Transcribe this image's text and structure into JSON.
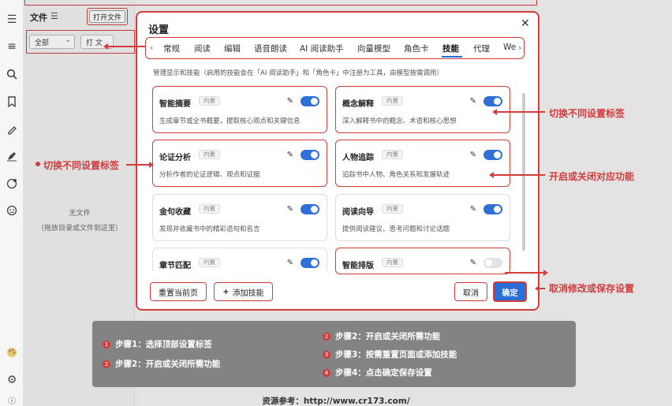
{
  "sidebar_icons": [
    "menu-icon",
    "list-icon",
    "search-icon",
    "bookmark-icon",
    "highlighter-icon",
    "pen-icon",
    "ai-icon",
    "emoji-icon",
    "palette-icon",
    "gear-icon",
    "info-icon"
  ],
  "file_panel": {
    "title": "文件",
    "list_icon": "☰",
    "open_button": "打开文件",
    "filter_all": "全部",
    "filter_type": "打 文",
    "empty_title": "无文件",
    "empty_hint": "（拖放目录或文件到这里）"
  },
  "dialog": {
    "title": "设置",
    "close": "✕",
    "tabs": [
      "常规",
      "阅读",
      "编辑",
      "语音朗读",
      "AI 阅读助手",
      "向量模型",
      "角色卡",
      "技能",
      "代理",
      "We"
    ],
    "active_tab": "技能",
    "description": "管理显示和技能（启用的技能会在「AI 阅读助手」和「角色卡」中注册为工具，由模型按需调用）",
    "badge_label": "内置",
    "skills": [
      {
        "name": "智能摘要",
        "desc": "生成章节或全书概要，提取核心观点和关键信息",
        "enabled": true
      },
      {
        "name": "概念解释",
        "desc": "深入解释书中的概念、术语和核心思想",
        "enabled": true
      },
      {
        "name": "论证分析",
        "desc": "分析作者的论证逻辑、观点和证据",
        "enabled": true
      },
      {
        "name": "人物追踪",
        "desc": "追踪书中人物、角色关系和发展轨迹",
        "enabled": true
      },
      {
        "name": "金句收藏",
        "desc": "发现并收藏书中的精彩语句和名言",
        "enabled": true
      },
      {
        "name": "阅读向导",
        "desc": "提供阅读建议、思考问题和讨论话题",
        "enabled": true
      },
      {
        "name": "章节匹配",
        "desc": "",
        "enabled": true
      },
      {
        "name": "智能排版",
        "desc": "",
        "enabled": false
      }
    ],
    "reset_button": "重置当前页",
    "add_skill_button": "添加技能",
    "add_icon": "+",
    "cancel_button": "取消",
    "confirm_button": "确定"
  },
  "annotations": {
    "switch_tabs_right": "切换不同设置标签",
    "switch_tabs_left": "切换不同设置标签",
    "toggle_feature": "开启或关闭对应功能",
    "cancel_or_save": "取消修改或保存设置"
  },
  "steps": [
    {
      "num": "1",
      "text": "步骤1：选择顶部设置标签"
    },
    {
      "num": "2",
      "text": "步骤2：开启或关闭所需功能"
    },
    {
      "num": "2",
      "text": "步骤2：开启或关闭所需功能"
    },
    {
      "num": "3",
      "text": "步骤3：按需重置页面或添加技能"
    },
    {
      "num": "4",
      "text": "步骤4：点击确定保存设置"
    }
  ],
  "footer": "资源参考：http://www.cr173.com/",
  "colors": {
    "accent": "#2b6fd6",
    "annotation": "#d23c3c",
    "toggle_off": "#e3e3e3"
  }
}
